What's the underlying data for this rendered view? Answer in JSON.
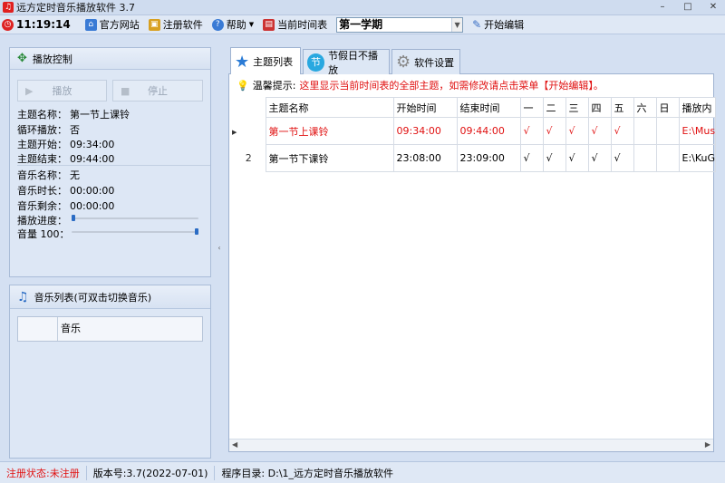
{
  "window": {
    "title": "远方定时音乐播放软件 3.7"
  },
  "toolbar": {
    "clock": "11:19:14",
    "official_site": "官方网站",
    "register": "注册软件",
    "help": "帮助",
    "timetable_label": "当前时间表",
    "semester": "第一学期",
    "start_edit": "开始编辑"
  },
  "play_control": {
    "header": "播放控制",
    "play_label": "播放",
    "stop_label": "停止",
    "theme_name_label": "主题名称：",
    "theme_name": "第一节上课铃",
    "loop_label": "循环播放：",
    "loop": "否",
    "start_label": "主题开始：",
    "start": "09:34:00",
    "end_label": "主题结束：",
    "end": "09:44:00",
    "music_name_label": "音乐名称：",
    "music_name": "无",
    "duration_label": "音乐时长：",
    "duration": "00:00:00",
    "remaining_label": "音乐剩余：",
    "remaining": "00:00:00",
    "progress_label": "播放进度：",
    "progress_fraction": 0.0,
    "volume_label": "音量 100：",
    "volume": 100
  },
  "music_list": {
    "header": "音乐列表(可双击切换音乐)",
    "column": "音乐"
  },
  "tabs": [
    {
      "label": "主题列表"
    },
    {
      "label": "节假日不播放"
    },
    {
      "label": "软件设置"
    }
  ],
  "tip": {
    "label": "温馨提示:",
    "text": "这里显示当前时间表的全部主题，如需修改请点击菜单【开始编辑】。"
  },
  "table": {
    "columns": [
      "主题名称",
      "开始时间",
      "结束时间",
      "一",
      "二",
      "三",
      "四",
      "五",
      "六",
      "日",
      "播放内"
    ],
    "rows": [
      {
        "index": "",
        "name": "第一节上课铃",
        "start": "09:34:00",
        "end": "09:44:00",
        "days": [
          "√",
          "√",
          "√",
          "√",
          "√",
          "",
          ""
        ],
        "content": "E:\\Musi"
      },
      {
        "index": "2",
        "name": "第一节下课铃",
        "start": "23:08:00",
        "end": "23:09:00",
        "days": [
          "√",
          "√",
          "√",
          "√",
          "√",
          "",
          ""
        ],
        "content": "E:\\KuGo"
      }
    ]
  },
  "status": {
    "register_state": "注册状态:未注册",
    "version": "版本号:3.7(2022-07-01)",
    "program_dir": "程序目录: D:\\1_远方定时音乐播放软件"
  },
  "colors": {
    "accent_red": "#e01010",
    "panel_bg": "#dde7f5"
  }
}
